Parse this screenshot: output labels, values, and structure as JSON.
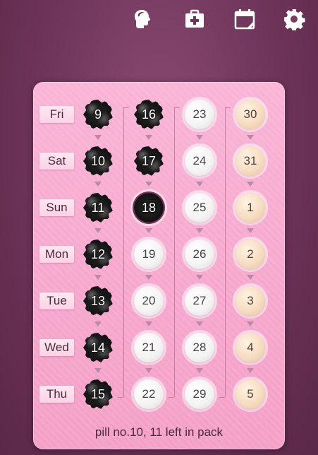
{
  "top_icons": [
    "profile-head-icon",
    "first-aid-kit-icon",
    "calendar-icon",
    "gear-icon"
  ],
  "days": [
    "Fri",
    "Sat",
    "Sun",
    "Mon",
    "Tue",
    "Wed",
    "Thu"
  ],
  "columns": [
    {
      "pills": [
        {
          "num": "9",
          "state": "taken"
        },
        {
          "num": "10",
          "state": "taken"
        },
        {
          "num": "11",
          "state": "taken"
        },
        {
          "num": "12",
          "state": "taken"
        },
        {
          "num": "13",
          "state": "taken"
        },
        {
          "num": "14",
          "state": "taken"
        },
        {
          "num": "15",
          "state": "taken"
        }
      ]
    },
    {
      "pills": [
        {
          "num": "16",
          "state": "taken"
        },
        {
          "num": "17",
          "state": "taken"
        },
        {
          "num": "18",
          "state": "current"
        },
        {
          "num": "19",
          "state": "white"
        },
        {
          "num": "20",
          "state": "white"
        },
        {
          "num": "21",
          "state": "white"
        },
        {
          "num": "22",
          "state": "white"
        }
      ]
    },
    {
      "pills": [
        {
          "num": "23",
          "state": "white"
        },
        {
          "num": "24",
          "state": "white"
        },
        {
          "num": "25",
          "state": "white"
        },
        {
          "num": "26",
          "state": "white"
        },
        {
          "num": "27",
          "state": "white"
        },
        {
          "num": "28",
          "state": "white"
        },
        {
          "num": "29",
          "state": "white"
        }
      ]
    },
    {
      "pills": [
        {
          "num": "30",
          "state": "placebo"
        },
        {
          "num": "31",
          "state": "placebo"
        },
        {
          "num": "1",
          "state": "placebo"
        },
        {
          "num": "2",
          "state": "placebo"
        },
        {
          "num": "3",
          "state": "placebo"
        },
        {
          "num": "4",
          "state": "placebo"
        },
        {
          "num": "5",
          "state": "placebo"
        }
      ]
    }
  ],
  "status_text": "pill no.10, 11 left in pack",
  "colors": {
    "pack": "#f6a6cc",
    "background": "#6e3459",
    "placebo": "#f6dcc0"
  }
}
